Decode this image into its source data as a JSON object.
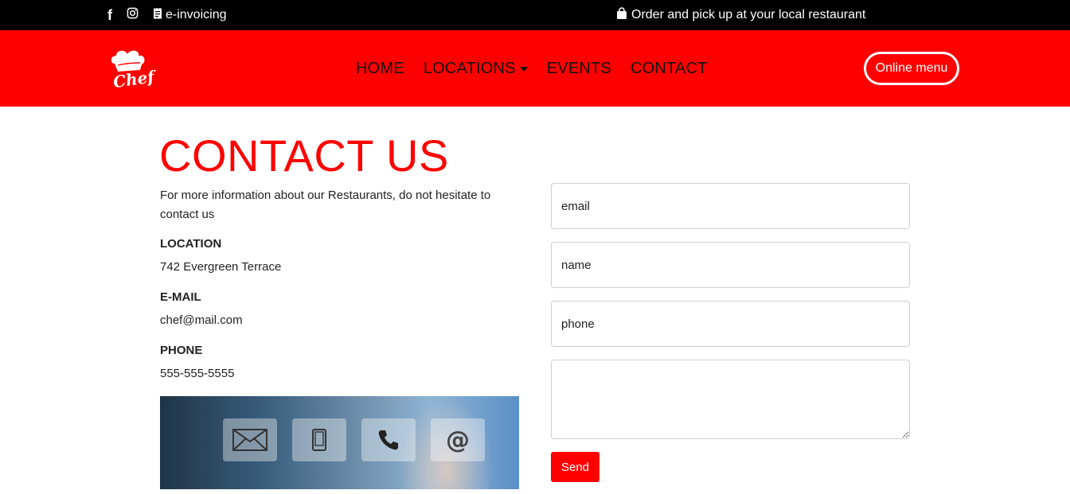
{
  "topbar": {
    "social": [
      {
        "icon": "facebook-icon",
        "glyph": "f"
      },
      {
        "icon": "instagram-icon",
        "glyph": ""
      }
    ],
    "einvoicing_label": "e-invoicing",
    "order_text": "Order and pick up at your local restaurant"
  },
  "nav": {
    "logo_text": "Chef",
    "items": [
      {
        "label": "HOME"
      },
      {
        "label": "LOCATIONS",
        "has_dropdown": true
      },
      {
        "label": "EVENTS"
      },
      {
        "label": "CONTACT"
      }
    ],
    "online_menu_label": "Online menu",
    "color": "#ff0000"
  },
  "contact": {
    "title": "CONTACT US",
    "intro": "For more information about our Restaurants, do not hesitate to contact us",
    "location_label": "LOCATION",
    "location_value": "742 Evergreen Terrace",
    "email_label": "E-MAIL",
    "email_value": "chef@mail.com",
    "phone_label": "PHONE",
    "phone_value": "555-555-5555",
    "banner_icons": [
      "envelope-icon",
      "mobile-icon",
      "phone-icon",
      "at-icon"
    ]
  },
  "form": {
    "email_placeholder": "email",
    "name_placeholder": "name",
    "phone_placeholder": "phone",
    "message_placeholder": "",
    "send_label": "Send"
  }
}
